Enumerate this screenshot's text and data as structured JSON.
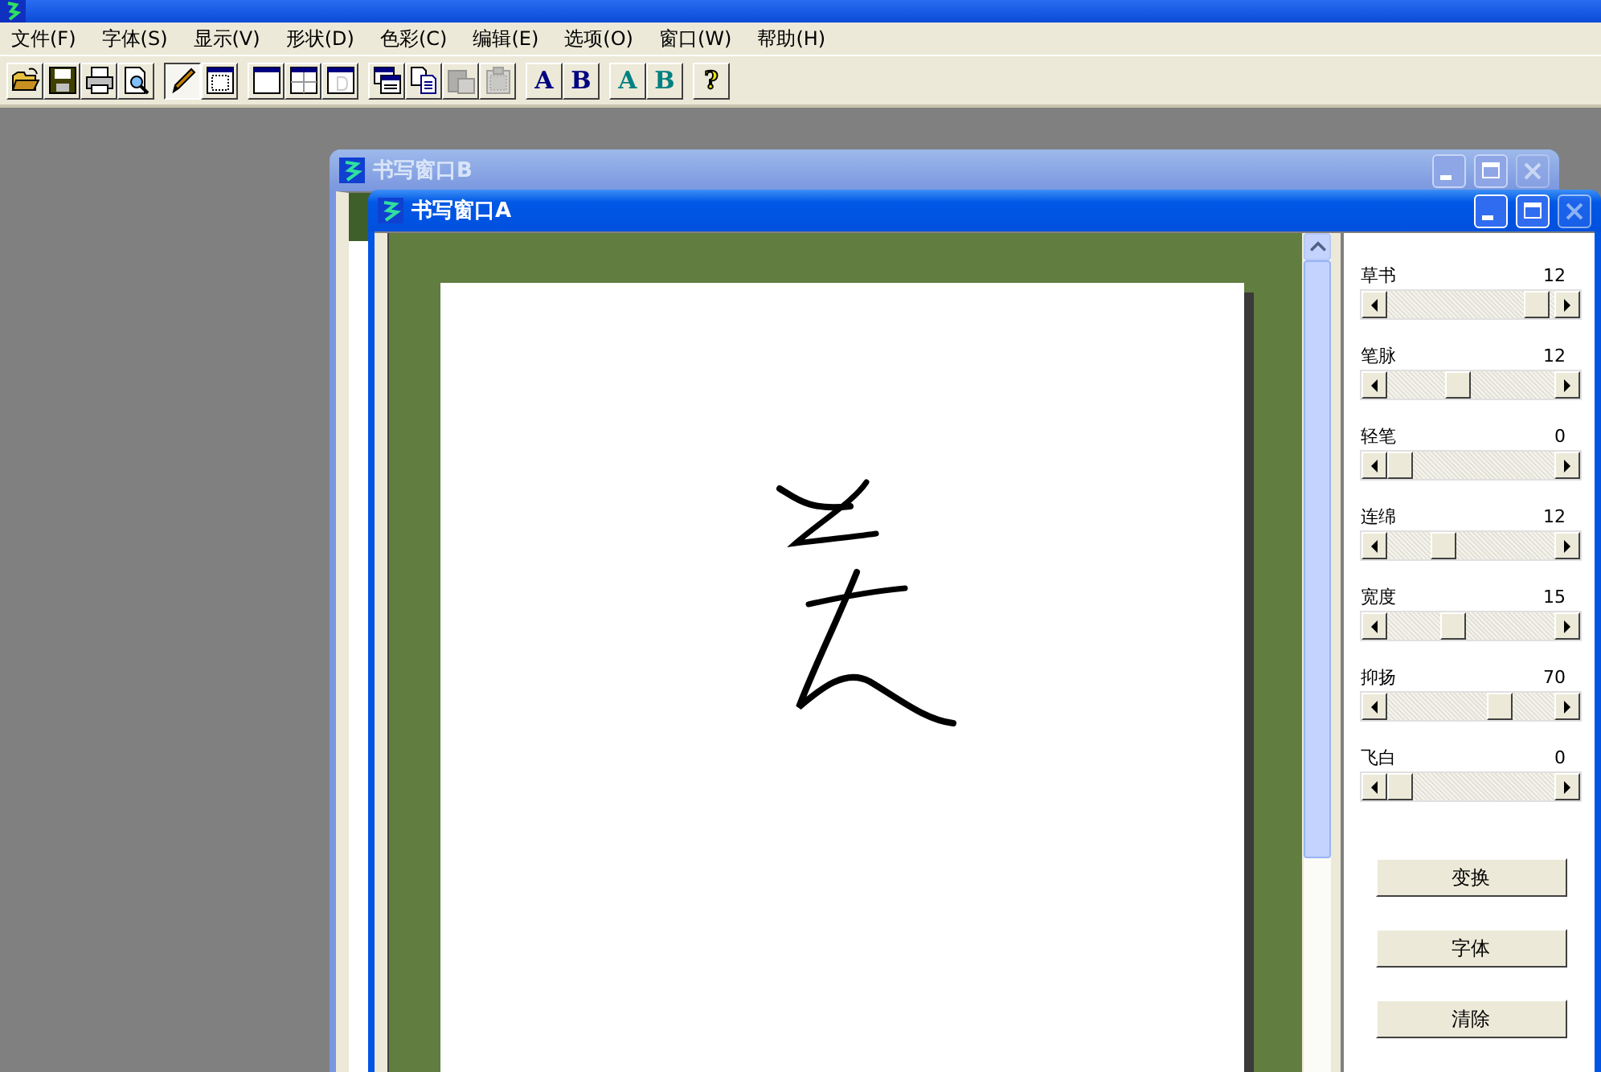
{
  "menu": [
    {
      "label": "文件(F)"
    },
    {
      "label": "字体(S)"
    },
    {
      "label": "显示(V)"
    },
    {
      "label": "形状(D)"
    },
    {
      "label": "色彩(C)"
    },
    {
      "label": "编辑(E)"
    },
    {
      "label": "选项(O)"
    },
    {
      "label": "窗口(W)"
    },
    {
      "label": "帮助(H)"
    }
  ],
  "toolbar": [
    [
      {
        "kind": "open",
        "pressed": false,
        "disabled": false
      },
      {
        "kind": "save",
        "pressed": false,
        "disabled": false
      },
      {
        "kind": "print",
        "pressed": false,
        "disabled": false
      },
      {
        "kind": "preview",
        "pressed": false,
        "disabled": false
      }
    ],
    [
      {
        "kind": "pen",
        "pressed": true,
        "disabled": false
      },
      {
        "kind": "frame",
        "pressed": false,
        "disabled": false
      }
    ],
    [
      {
        "kind": "window",
        "pressed": false,
        "disabled": false
      },
      {
        "kind": "split",
        "pressed": false,
        "disabled": false
      },
      {
        "kind": "page",
        "pressed": false,
        "disabled": false
      }
    ],
    [
      {
        "kind": "cascade",
        "pressed": false,
        "disabled": false
      },
      {
        "kind": "copy",
        "pressed": false,
        "disabled": false
      },
      {
        "kind": "paste",
        "pressed": false,
        "disabled": true
      },
      {
        "kind": "clipboard",
        "pressed": false,
        "disabled": true
      }
    ],
    [
      {
        "kind": "letter",
        "label": "A",
        "color": "#000080",
        "pressed": false,
        "disabled": false
      },
      {
        "kind": "letter",
        "label": "B",
        "color": "#000080",
        "pressed": false,
        "disabled": false
      }
    ],
    [
      {
        "kind": "letter",
        "label": "A",
        "color": "#008080",
        "pressed": false,
        "disabled": false
      },
      {
        "kind": "letter",
        "label": "B",
        "color": "#008080",
        "pressed": false,
        "disabled": false
      }
    ],
    [
      {
        "kind": "letter",
        "label": "?",
        "color": "#e8e800",
        "pressed": false,
        "disabled": false
      }
    ]
  ],
  "windows": [
    {
      "title": "书写窗口B",
      "active": false,
      "close_disabled": true
    },
    {
      "title": "书写窗口A",
      "active": true,
      "close_disabled": true,
      "sliders": [
        {
          "label": "草书",
          "value": "12",
          "level": 0.96
        },
        {
          "label": "笔脉",
          "value": "12",
          "level": 0.41
        },
        {
          "label": "轻笔",
          "value": "0",
          "level": 0
        },
        {
          "label": "连绵",
          "value": "12",
          "level": 0.3
        },
        {
          "label": "宽度",
          "value": "15",
          "level": 0.37
        },
        {
          "label": "抑扬",
          "value": "70",
          "level": 0.7
        },
        {
          "label": "飞白",
          "value": "0",
          "level": 0
        }
      ],
      "buttons": [
        {
          "label": "变换"
        },
        {
          "label": "字体"
        },
        {
          "label": "清除"
        }
      ]
    }
  ]
}
